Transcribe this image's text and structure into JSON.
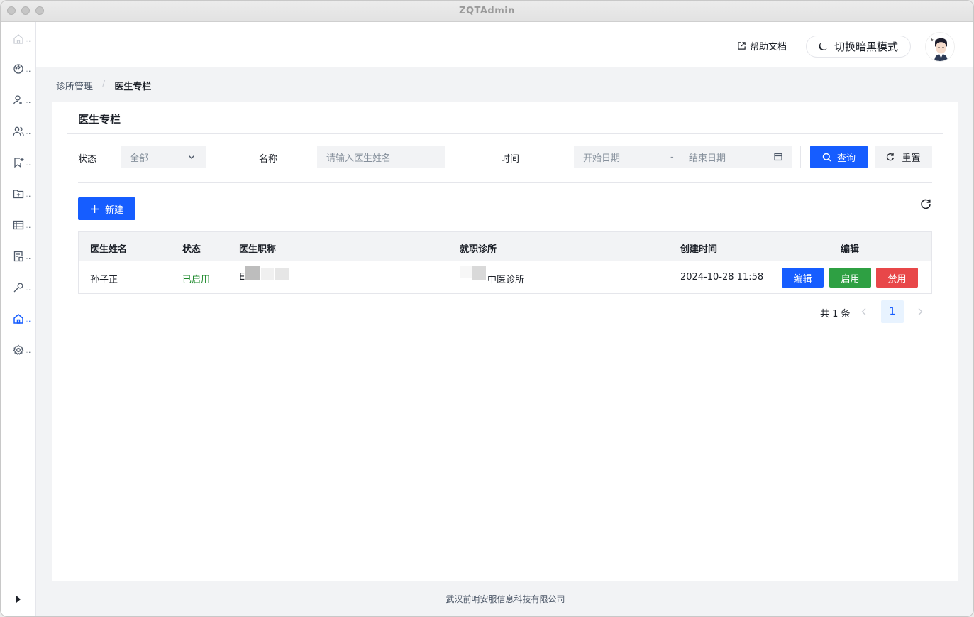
{
  "window": {
    "title": "ZQTAdmin"
  },
  "sidebar": {
    "items": [
      {
        "icon": "home-icon"
      },
      {
        "icon": "dashboard-icon",
        "dots": "..."
      },
      {
        "icon": "user-add-icon",
        "dots": "..."
      },
      {
        "icon": "users-icon",
        "dots": "..."
      },
      {
        "icon": "bookmark-add-icon",
        "dots": "..."
      },
      {
        "icon": "folder-add-icon",
        "dots": "..."
      },
      {
        "icon": "table-icon",
        "dots": "..."
      },
      {
        "icon": "form-icon",
        "dots": "..."
      },
      {
        "icon": "tool-icon",
        "dots": "..."
      },
      {
        "icon": "clinic-home-icon",
        "dots": "...",
        "active": true
      },
      {
        "icon": "settings-icon",
        "dots": "..."
      }
    ]
  },
  "topbar": {
    "help": "帮助文档",
    "dark_mode": "切换暗黑模式"
  },
  "breadcrumb": {
    "parent": "诊所管理",
    "sep": "/",
    "current": "医生专栏"
  },
  "card": {
    "title": "医生专栏"
  },
  "filters": {
    "status_label": "状态",
    "status_value": "全部",
    "name_label": "名称",
    "name_placeholder": "请输入医生姓名",
    "time_label": "时间",
    "start_placeholder": "开始日期",
    "range_sep": "-",
    "end_placeholder": "结束日期",
    "search_btn": "查询",
    "reset_btn": "重置"
  },
  "toolbar": {
    "new_btn": "新建"
  },
  "table": {
    "headers": [
      "医生姓名",
      "状态",
      "医生职称",
      "就职诊所",
      "创建时间",
      "编辑"
    ],
    "rows": [
      {
        "name": "孙子正",
        "status": "已启用",
        "title_visible": "E",
        "clinic_visible": "中医诊所",
        "created": "2024-10-28 11:58",
        "edit_btn": "编辑",
        "enable_btn": "启用",
        "disable_btn": "禁用"
      }
    ]
  },
  "pagination": {
    "total": "共 1 条",
    "current_page": "1"
  },
  "footer": "武汉前哨安服信息科技有限公司",
  "colors": {
    "primary": "#165dff",
    "success": "#2ea043",
    "danger": "#e84749"
  }
}
